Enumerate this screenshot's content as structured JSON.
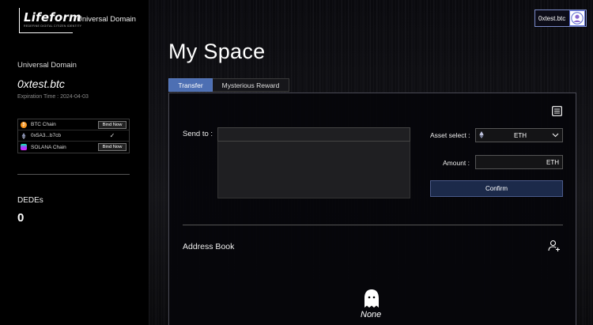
{
  "brand": {
    "logo_main": "Lifeform",
    "logo_sub": "REDEFINE DIGITAL CITIZEN IDENTITY",
    "product": "Universal Domain"
  },
  "sidebar": {
    "section_label": "Universal Domain",
    "domain_name": "0xtest.btc",
    "expiration": "Expiration Time : 2024-04-03",
    "chains": [
      {
        "label": "BTC Chain",
        "action": "Bind Now",
        "icon": "btc-icon",
        "color": "#f7931a"
      },
      {
        "label": "0x5A3...b7cb",
        "action": "✓",
        "icon": "eth-icon",
        "color": "#8a92b2"
      },
      {
        "label": "SOLANA Chain",
        "action": "Bind Now",
        "icon": "solana-icon",
        "color": "#9945ff"
      }
    ],
    "dedes_label": "DEDEs",
    "dedes_value": "0"
  },
  "header": {
    "user_name": "0xtest.btc"
  },
  "main": {
    "title": "My Space",
    "tabs": [
      {
        "label": "Transfer",
        "active": true
      },
      {
        "label": "Mysterious Reward",
        "active": false
      }
    ],
    "transfer": {
      "send_to_label": "Send to :",
      "send_to_value": "",
      "asset_label": "Asset select :",
      "asset_value": "ETH",
      "amount_label": "Amount :",
      "amount_unit": "ETH",
      "confirm_label": "Confirm"
    },
    "address_book": {
      "label": "Address Book",
      "empty_text": "None"
    }
  },
  "colors": {
    "accent": "#4d6fb3",
    "confirm_bg": "#1c2a4a",
    "background": "#000000"
  }
}
